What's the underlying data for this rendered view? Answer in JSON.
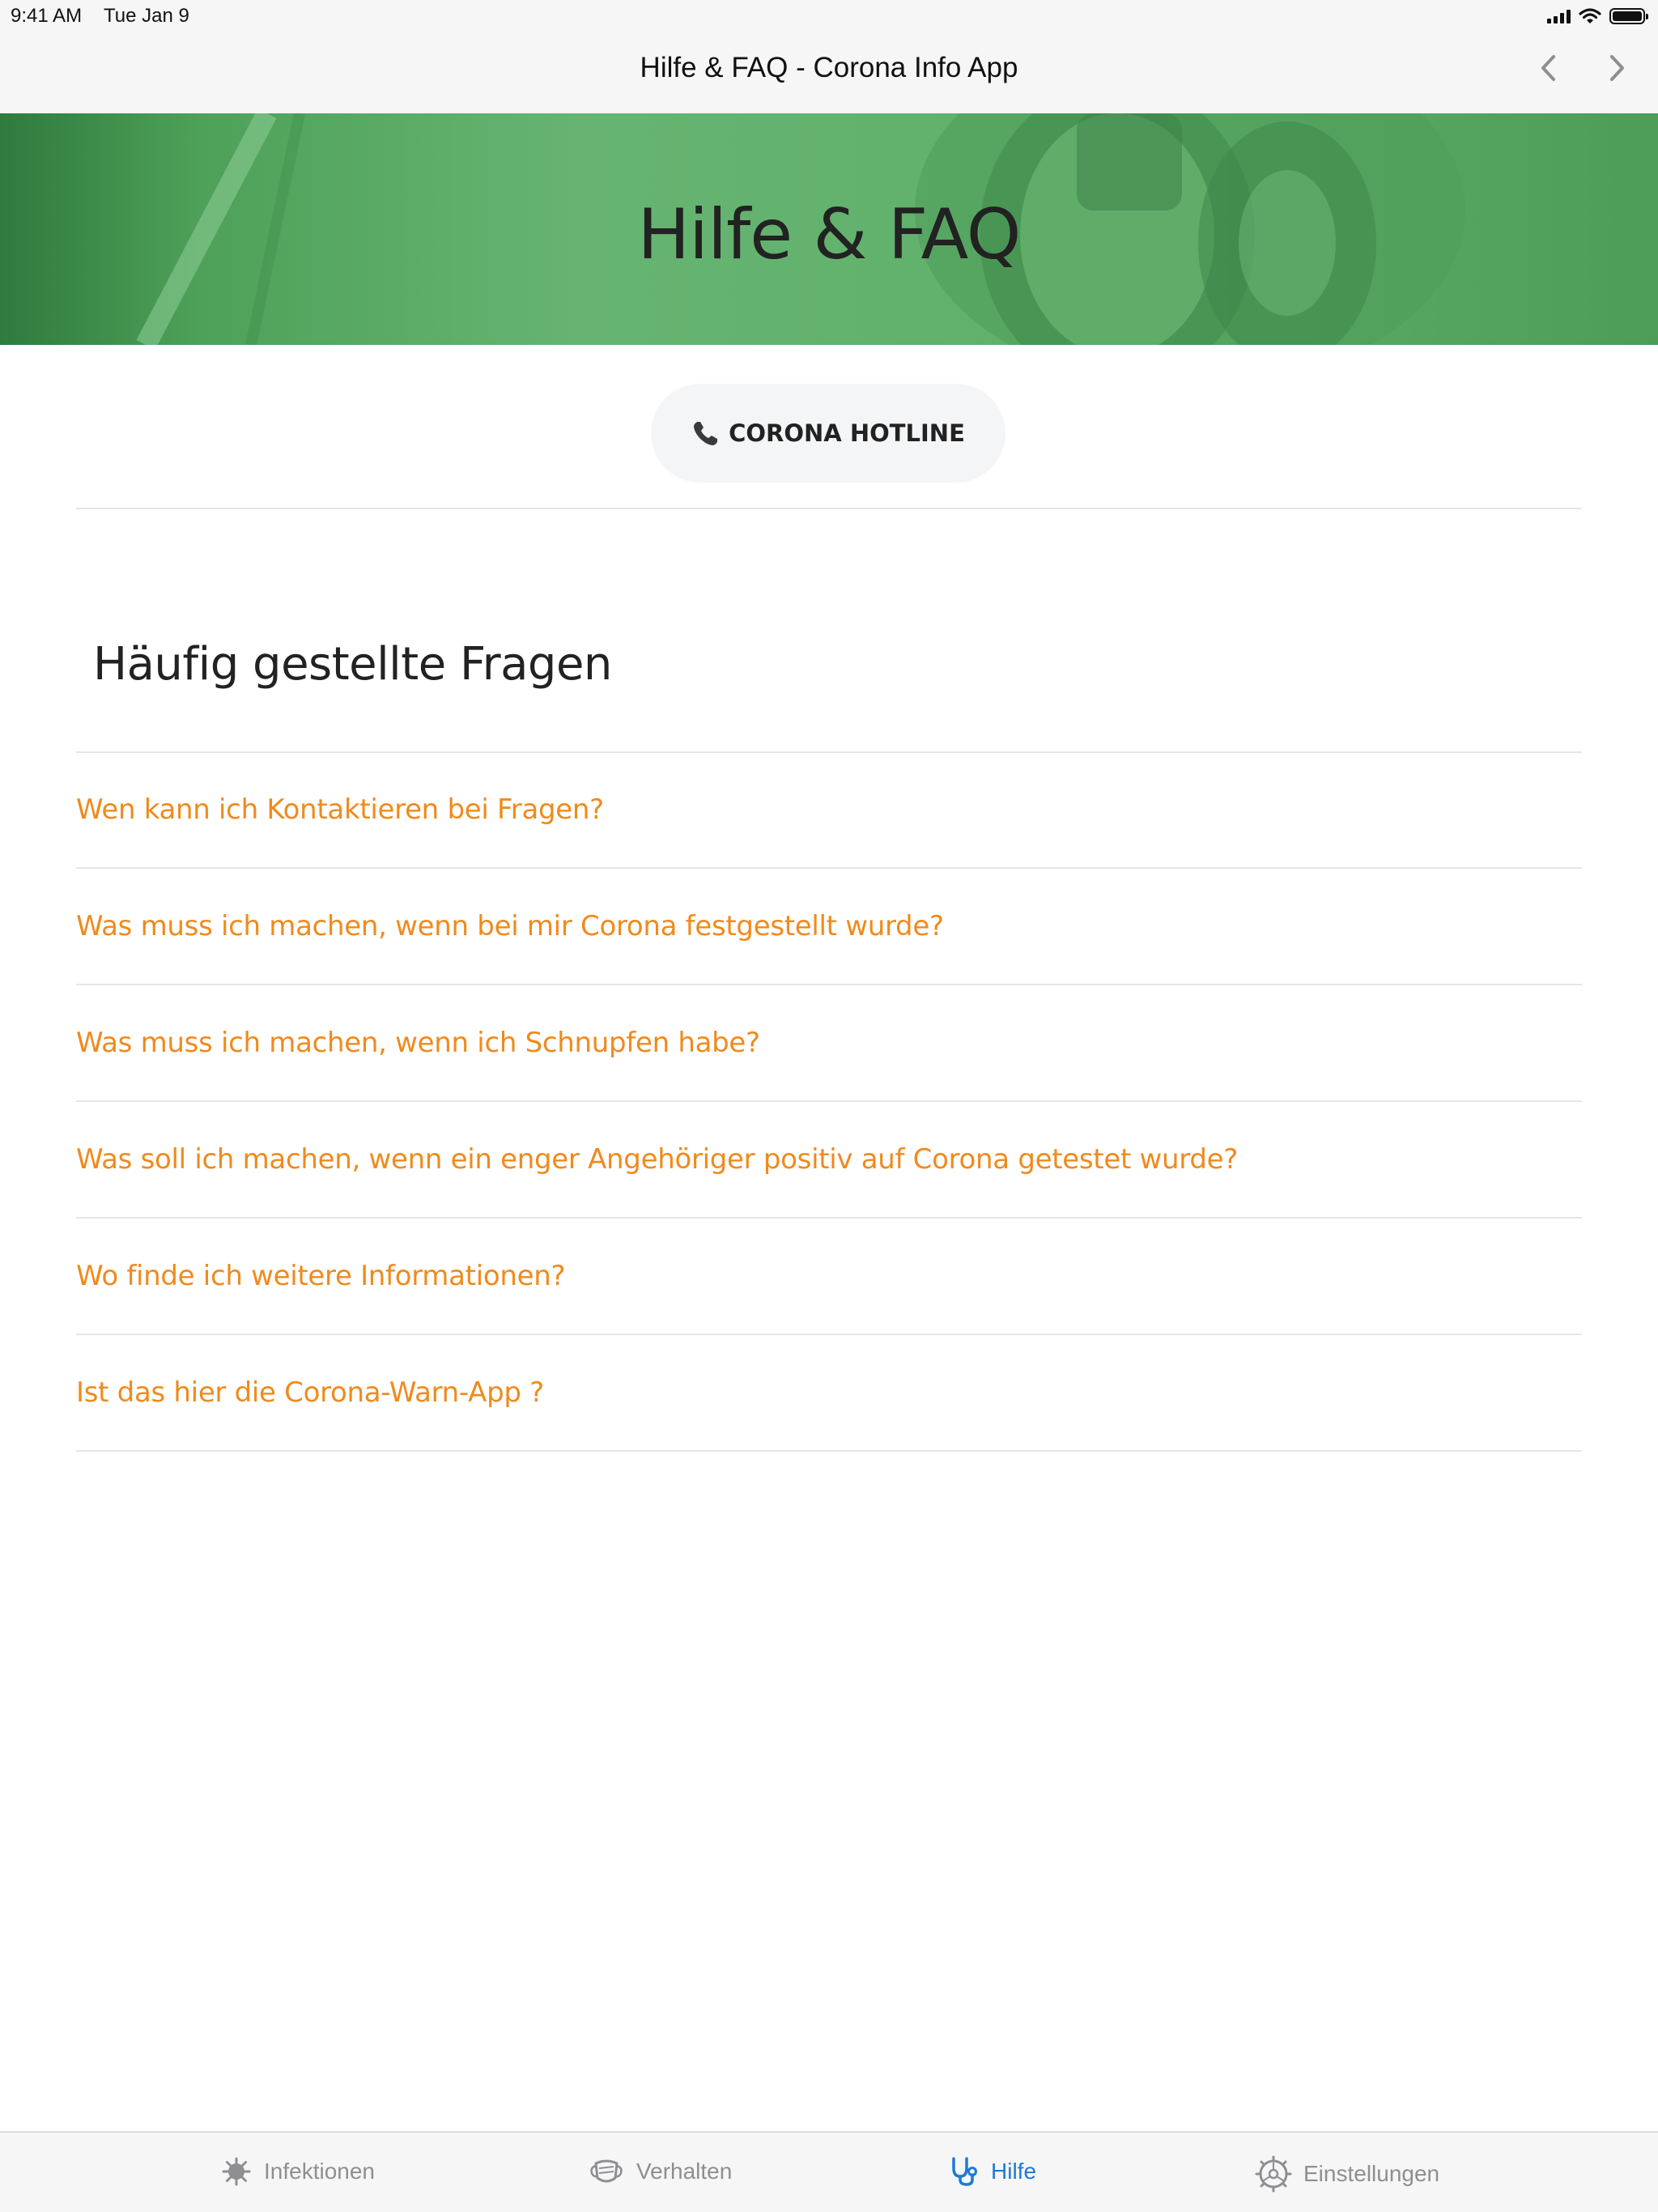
{
  "status_bar": {
    "time": "9:41 AM",
    "date": "Tue Jan 9"
  },
  "nav": {
    "title": "Hilfe & FAQ - Corona Info App",
    "back_icon": "chevron-left-icon",
    "forward_icon": "chevron-right-icon"
  },
  "hero": {
    "title": "Hilfe & FAQ"
  },
  "hotline": {
    "label": "CORONA HOTLINE",
    "icon": "phone-icon"
  },
  "faq": {
    "heading": "Häufig gestellte Fragen",
    "items": [
      "Wen kann ich Kontaktieren bei Fragen?",
      "Was muss ich machen, wenn bei mir Corona festgestellt wurde?",
      "Was muss ich machen, wenn ich Schnupfen habe?",
      "Was soll ich machen, wenn ein enger Angehöriger positiv auf Corona getestet wurde?",
      "Wo finde ich weitere Informationen?",
      "Ist das hier die Corona-Warn-App ?"
    ]
  },
  "tabs": [
    {
      "label": "Infektionen",
      "icon": "virus-icon",
      "active": false
    },
    {
      "label": "Verhalten",
      "icon": "mask-icon",
      "active": false
    },
    {
      "label": "Hilfe",
      "icon": "stethoscope-icon",
      "active": true
    },
    {
      "label": "Einstellungen",
      "icon": "gear-icon",
      "active": false
    }
  ],
  "colors": {
    "accent": "#f08a1c",
    "active_tab": "#1b7ad8",
    "hero_green": "#5eaf69"
  }
}
